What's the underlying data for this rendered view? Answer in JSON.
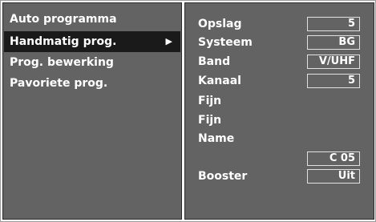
{
  "left_menu": {
    "items": [
      {
        "label": "Auto programma",
        "selected": false
      },
      {
        "label": "Handmatig prog.",
        "selected": true
      },
      {
        "label": "Prog. bewerking",
        "selected": false
      },
      {
        "label": "Pavoriete prog.",
        "selected": false
      }
    ],
    "selected_arrow": "▶"
  },
  "settings": {
    "opslag": {
      "label": "Opslag",
      "value": "5"
    },
    "systeem": {
      "label": "Systeem",
      "value": "BG"
    },
    "band": {
      "label": "Band",
      "value": "V/UHF"
    },
    "kanaal": {
      "label": "Kanaal",
      "value": "5"
    },
    "fijn_1": {
      "label": "Fijn"
    },
    "fijn_2": {
      "label": "Fijn"
    },
    "name": {
      "label": "Name",
      "value": "C 05"
    },
    "booster": {
      "label": "Booster",
      "value": "Uit"
    }
  },
  "colors": {
    "panel_bg": "#636363",
    "selected_bg": "#1a1a1a",
    "text": "#ffffff",
    "box_border": "#e0e0e0"
  },
  "icons": {
    "selected_item_marker": "arrow-right-icon"
  }
}
